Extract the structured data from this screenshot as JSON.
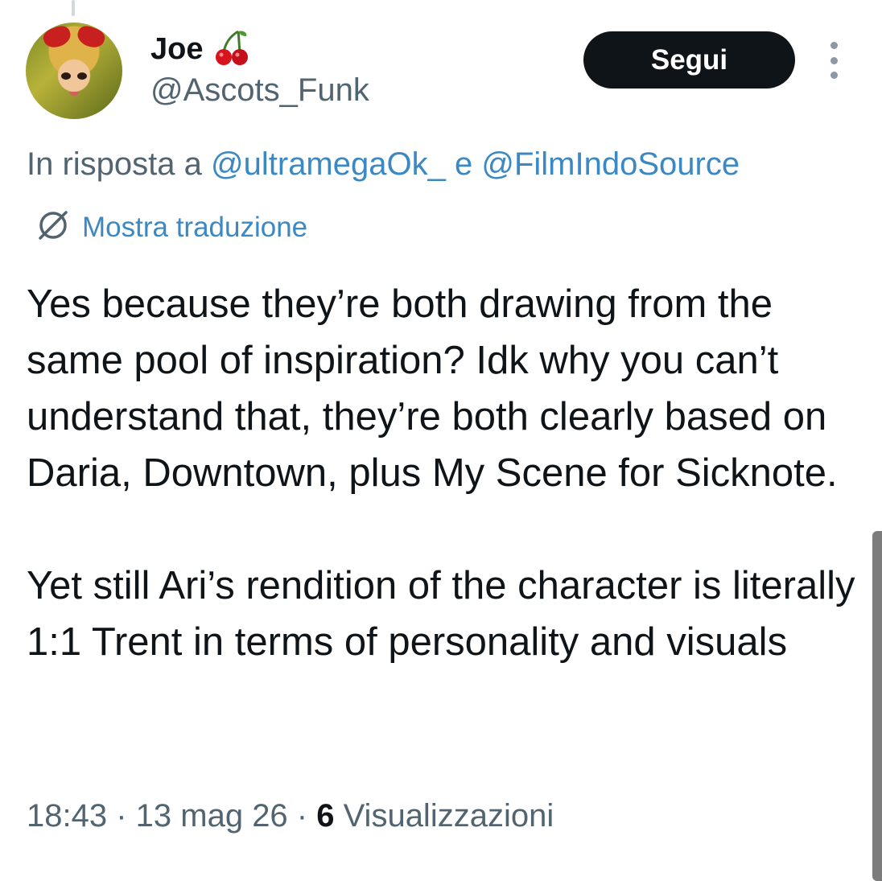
{
  "author": {
    "display_name": "Joe",
    "emoji": "🍒",
    "handle": "@Ascots_Funk"
  },
  "actions": {
    "follow_label": "Segui"
  },
  "reply_context": {
    "prefix": "In risposta a ",
    "mention_1": "@ultramegaOk_",
    "joiner": " e ",
    "mention_2": "@FilmIndoSource"
  },
  "translate": {
    "label": "Mostra traduzione"
  },
  "tweet": {
    "paragraph_1": "Yes because they’re both drawing from the same pool of inspiration? Idk why you can’t understand that, they’re both clearly based on Daria, Downtown, plus My Scene for Sicknote.",
    "paragraph_2": "Yet still Ari’s rendition of the character is literally 1:1 Trent in terms of personality and visuals"
  },
  "meta": {
    "time": "18:43",
    "sep_1": " · ",
    "date": "13 mag 26",
    "sep_2": " · ",
    "views_count": "6",
    "views_label": " Visualizzazioni"
  },
  "icons": {
    "more": "more-vertical-icon",
    "translate": "globe-slash-icon"
  },
  "colors": {
    "link": "#3b88c3",
    "muted": "#536471",
    "button_bg": "#0f1419"
  }
}
